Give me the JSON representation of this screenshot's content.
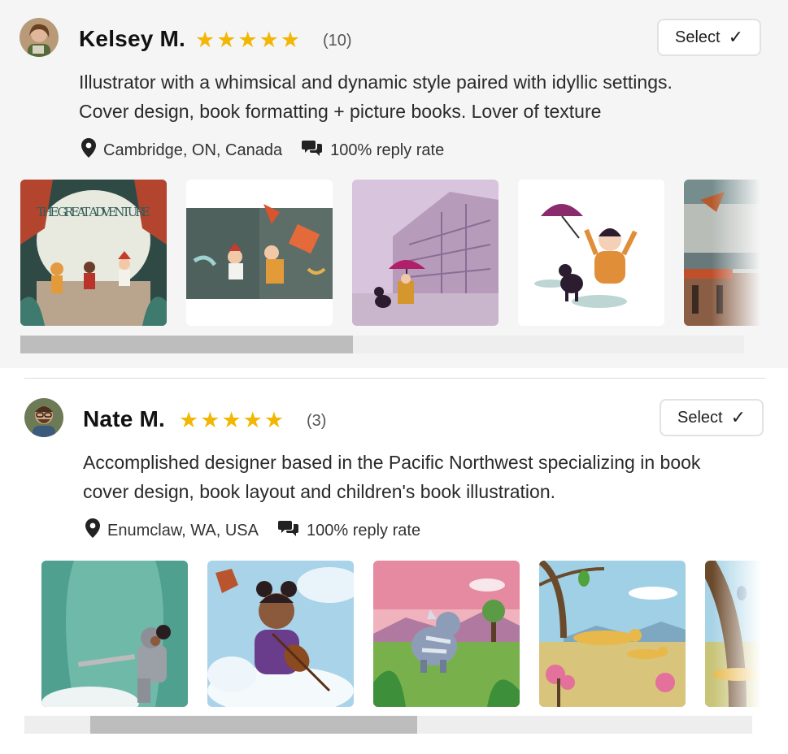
{
  "designers": [
    {
      "name": "Kelsey M.",
      "rating_stars": 5,
      "review_count": "(10)",
      "select_label": "Select",
      "bio_line1": "Illustrator with a whimsical and dynamic style paired with idyllic settings.",
      "bio_line2": "Cover design, book formatting + picture books. Lover of texture",
      "location": "Cambridge, ON, Canada",
      "reply_rate": "100% reply rate",
      "portfolio_title_text": "THE GREAT ADVENTURE",
      "scroll_position": 0.0,
      "scroll_visible_fraction": 0.46
    },
    {
      "name": "Nate M.",
      "rating_stars": 5,
      "review_count": "(3)",
      "select_label": "Select",
      "bio_line1": "Accomplished designer based in the Pacific Northwest specializing in book",
      "bio_line2": "cover design, book layout and children's book illustration.",
      "location": "Enumclaw, WA, USA",
      "reply_rate": "100% reply rate",
      "scroll_position": 0.09,
      "scroll_visible_fraction": 0.45
    }
  ],
  "icons": {
    "star": "star-icon",
    "check": "checkmark-icon",
    "location": "map-pin-icon",
    "reply": "chat-bubbles-icon"
  },
  "colors": {
    "star": "#f2b705",
    "card_bg": "#f5f5f5",
    "scroll_thumb": "#bdbdbd",
    "scroll_track": "#eeeeee"
  }
}
